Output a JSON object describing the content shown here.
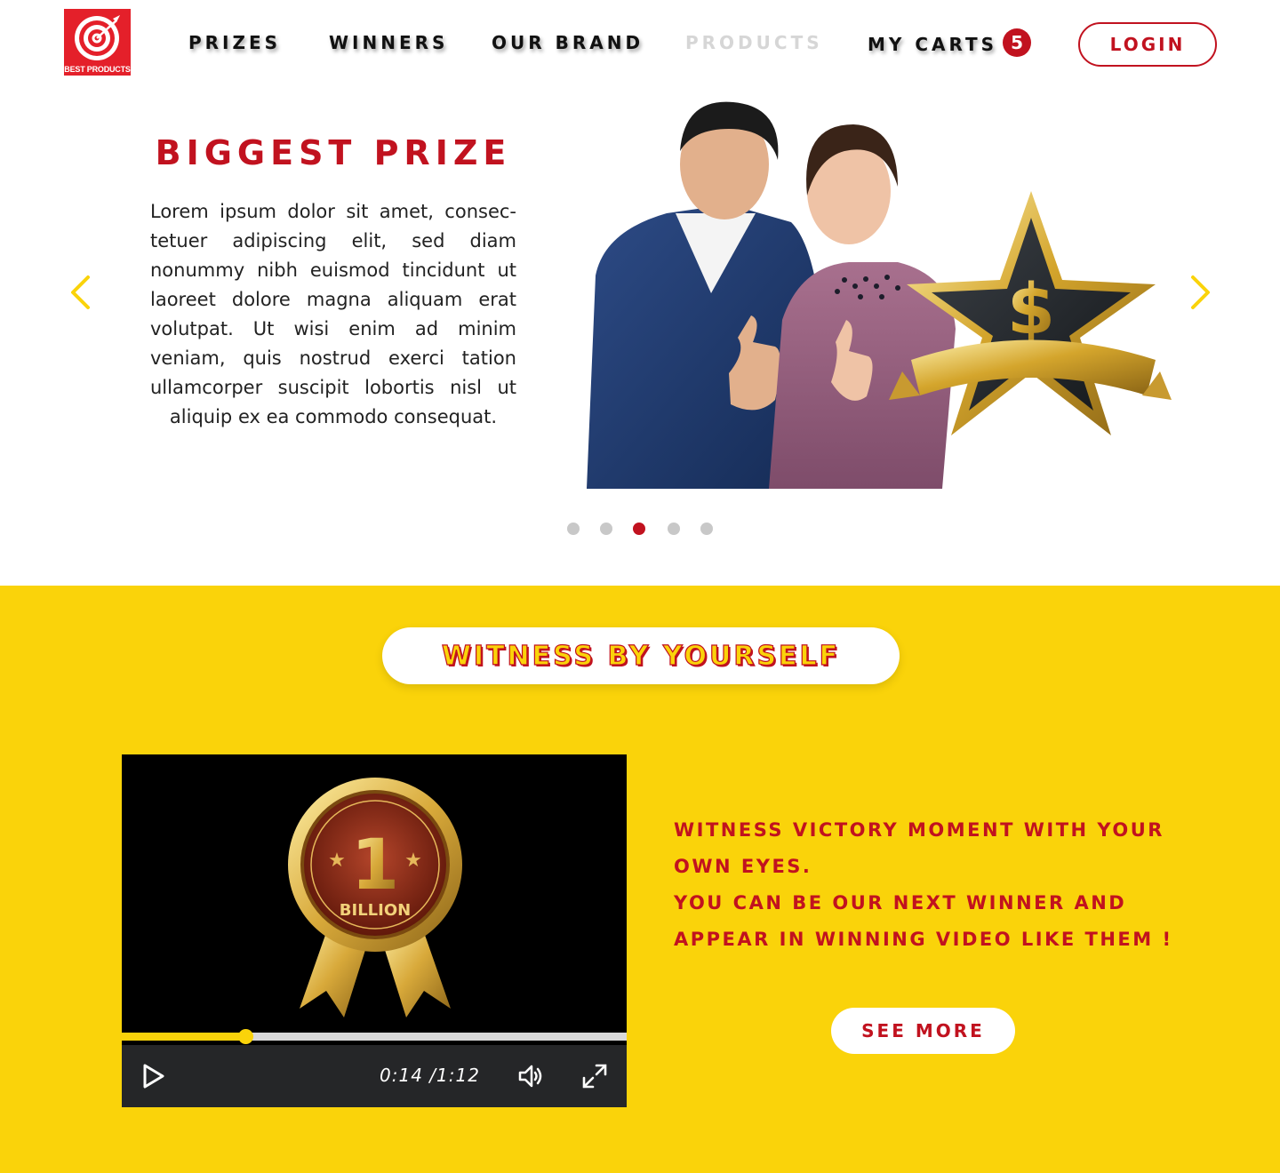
{
  "header": {
    "logo_text": "BEST PRODUCTS",
    "nav": [
      {
        "label": "PRIZES"
      },
      {
        "label": "WINNERS"
      },
      {
        "label": "OUR BRAND"
      },
      {
        "label": "PRODUCTS",
        "state": "disabled"
      },
      {
        "label": "MY CARTS"
      }
    ],
    "cart_count": "5",
    "login_label": "LOGIN"
  },
  "hero": {
    "title": "BIGGEST PRIZE",
    "text": "Lorem ipsum dolor sit amet, consec­tetuer adipiscing elit, sed diam nonum­my nibh euismod tincidunt ut laoreet dolore magna aliquam erat volutpat. Ut wisi enim ad minim veniam, quis nos­trud exerci tation ullamcorper suscipit lobortis nisl ut aliquip ex ea commodo consequat.",
    "prev_icon": "chevron-left-icon",
    "next_icon": "chevron-right-icon",
    "slides_total": 5,
    "active_slide": 3
  },
  "witness": {
    "heading": "WITNESS BY YOURSELF",
    "video": {
      "badge_text": "BILLION",
      "badge_number": "1",
      "current_time": "0:14",
      "duration": "/1:12",
      "progress": 0.245,
      "play_icon": "play-icon",
      "volume_icon": "volume-icon",
      "fullscreen_icon": "fullscreen-icon"
    },
    "line1": "WITNESS VICTORY MOMENT WITH YOUR",
    "line2": "OWN EYES.",
    "line3": "YOU CAN BE OUR NEXT WINNER AND",
    "line4": "APPEAR IN WINNING VIDEO LIKE THEM !",
    "see_more_label": "SEE MORE"
  },
  "colors": {
    "brand_red": "#c1121f",
    "accent_yellow": "#fad30a",
    "logo_red": "#e4202a"
  }
}
